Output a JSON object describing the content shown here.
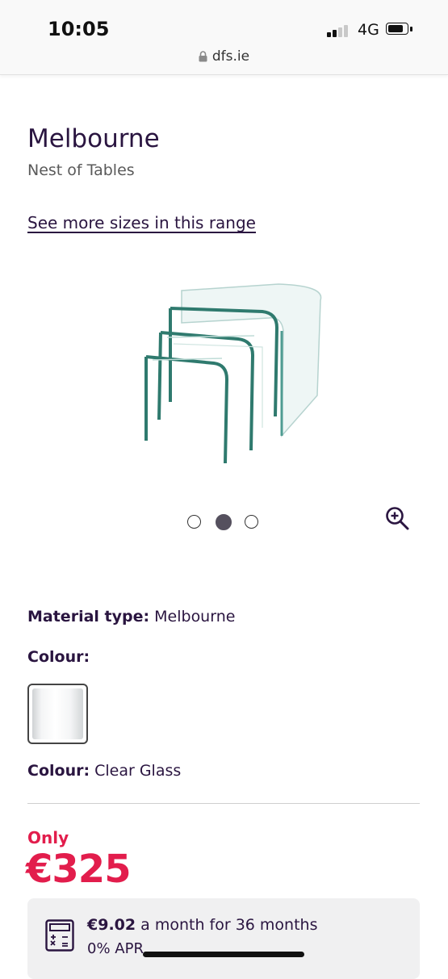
{
  "status_bar": {
    "time": "10:05",
    "network": "4G",
    "url": "dfs.ie"
  },
  "product": {
    "name": "Melbourne",
    "type": "Nest of Tables",
    "sizes_link": "See more sizes in this range",
    "image_alt_icon": "nest-of-tables-image",
    "carousel": {
      "count": 3,
      "active_index": 1
    }
  },
  "details": {
    "material_label": "Material type:",
    "material_value": "Melbourne",
    "colour_label": "Colour:",
    "selected_colour_label": "Colour:",
    "selected_colour_value": "Clear Glass"
  },
  "pricing": {
    "only_label": "Only",
    "price": "€325"
  },
  "finance": {
    "monthly_amount": "€9.02",
    "monthly_text": "a month for 36 months",
    "apr": "0% APR"
  },
  "colors": {
    "brand_purple": "#2a1540",
    "price_red": "#e21d4c"
  }
}
